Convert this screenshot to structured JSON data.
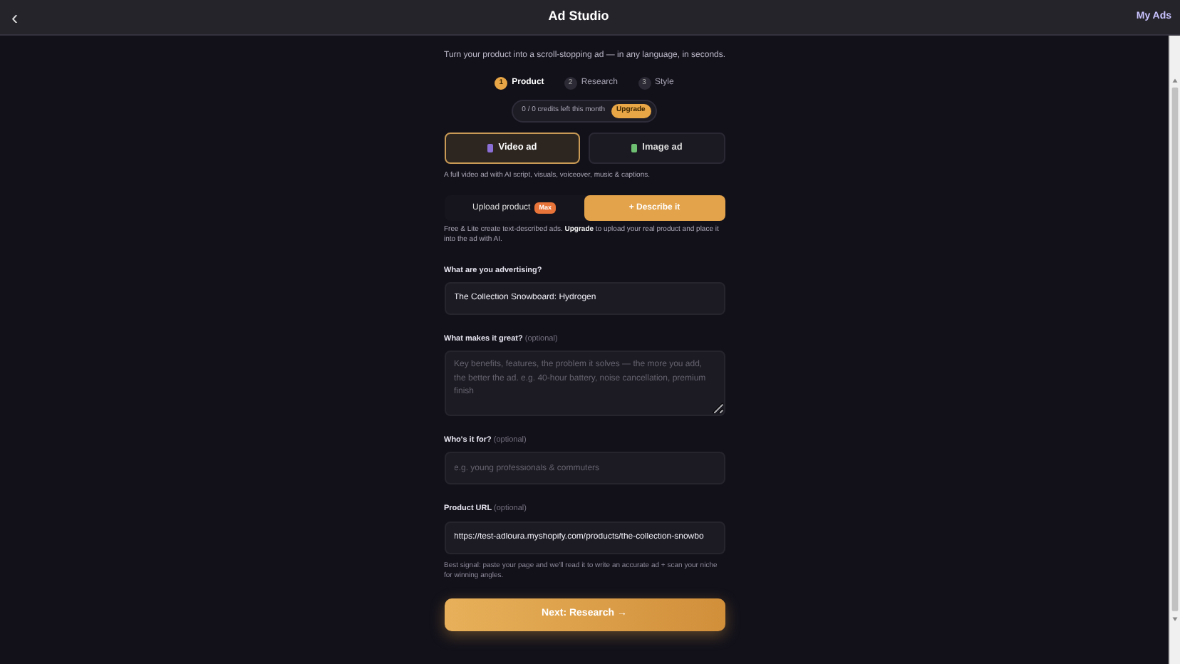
{
  "header": {
    "back": "‹",
    "title": "Ad Studio",
    "link": "My Ads"
  },
  "subtitle": "Turn your product into a scroll-stopping ad — in any language, in seconds.",
  "steps": [
    {
      "number": "1",
      "label": "Product",
      "selected": true
    },
    {
      "number": "2",
      "label": "Research",
      "selected": false
    },
    {
      "number": "3",
      "label": "Style",
      "selected": false
    }
  ],
  "credits": {
    "text": "0 / 0 credits left this month",
    "button": "Upgrade"
  },
  "ad_types": [
    {
      "label": "Video ad",
      "selected": true,
      "color": "#8b6fd6"
    },
    {
      "label": "Image ad",
      "selected": false,
      "color": "#6fbf73"
    }
  ],
  "ad_type_description": "A full video ad with AI script, visuals, voiceover, music & captions.",
  "sources": [
    {
      "label": "Upload product",
      "badge": "Max",
      "selected": false
    },
    {
      "label": "+ Describe it",
      "selected": true
    }
  ],
  "source_note": "Free & Lite create text-described ads. **Upgrade** to upload your real product and place it into the ad with AI.",
  "fields": [
    {
      "kind": "input",
      "label": "What are you advertising?",
      "value": "The Collection Snowboard: Hydrogen"
    },
    {
      "kind": "textarea",
      "label": "What makes it great?",
      "optional": "(optional)",
      "placeholder": "Key benefits, features, the problem it solves — the more you add, the better the ad. e.g. 40-hour battery, noise cancellation, premium finish"
    },
    {
      "kind": "input",
      "label": "Who's it for?",
      "optional": "(optional)",
      "placeholder": "e.g. young professionals & commuters"
    },
    {
      "kind": "input",
      "label": "Product URL",
      "optional": "(optional)",
      "value": "https://test-adloura.myshopify.com/products/the-collection-snowbo"
    }
  ],
  "url_help": "Best signal: paste your page and we'll read it to write an accurate ad + scan your niche for winning angles.",
  "next_button": "Next: Research →"
}
